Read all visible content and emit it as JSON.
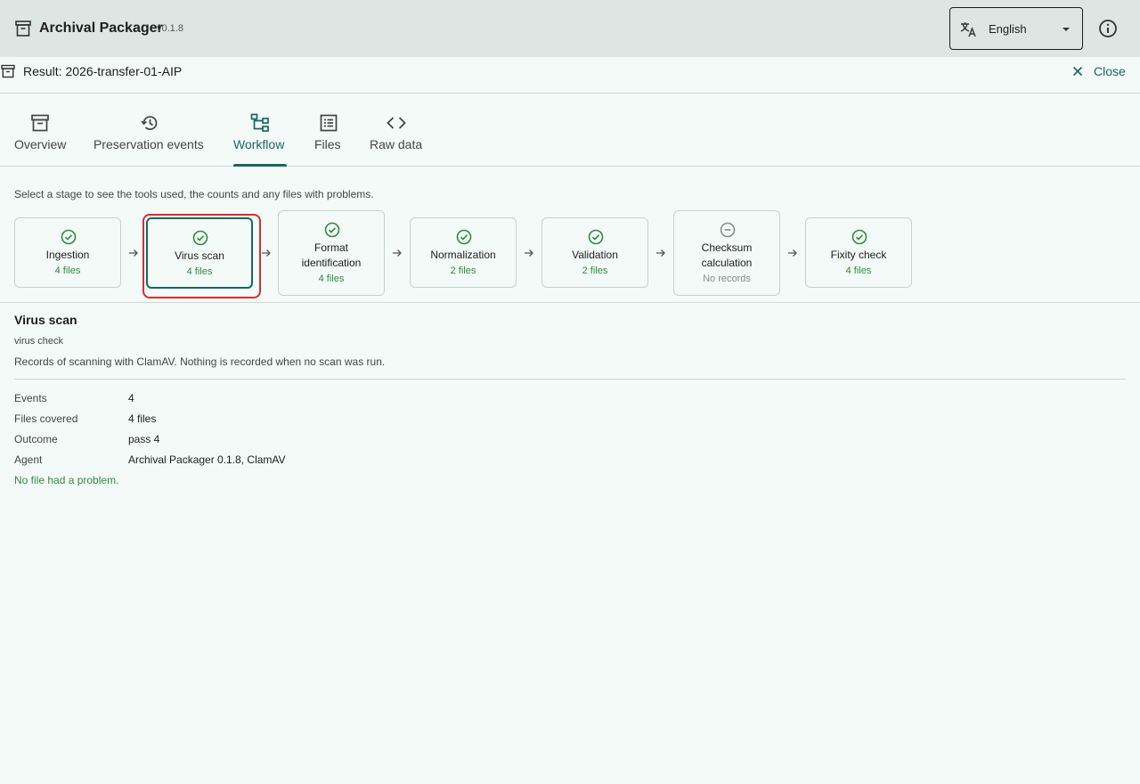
{
  "app": {
    "title": "Archival Packager",
    "version": "v0.1.8"
  },
  "language": {
    "selected": "English"
  },
  "result": {
    "title": "Result: 2026-transfer-01-AIP",
    "close_label": "Close"
  },
  "tabs": [
    {
      "label": "Overview",
      "icon": "archive-icon"
    },
    {
      "label": "Preservation events",
      "icon": "history-icon"
    },
    {
      "label": "Workflow",
      "icon": "workflow-icon",
      "active": true
    },
    {
      "label": "Files",
      "icon": "list-icon"
    },
    {
      "label": "Raw data",
      "icon": "code-icon"
    }
  ],
  "instructions": "Select a stage to see the tools used, the counts and any files with problems.",
  "stages": [
    {
      "name": "Ingestion",
      "count": "4 files",
      "status": "success"
    },
    {
      "name": "Virus scan",
      "count": "4 files",
      "status": "success",
      "selected": true
    },
    {
      "name": "Format identification",
      "count": "4 files",
      "status": "success"
    },
    {
      "name": "Normalization",
      "count": "2 files",
      "status": "success"
    },
    {
      "name": "Validation",
      "count": "2 files",
      "status": "success"
    },
    {
      "name": "Checksum calculation",
      "count": "No records",
      "status": "none"
    },
    {
      "name": "Fixity check",
      "count": "4 files",
      "status": "success"
    }
  ],
  "detail": {
    "title": "Virus scan",
    "subtitle": "virus check",
    "description": "Records of scanning with ClamAV. Nothing is recorded when no scan was run.",
    "rows": [
      {
        "key": "Events",
        "value": "4"
      },
      {
        "key": "Files covered",
        "value": "4 files"
      },
      {
        "key": "Outcome",
        "value": "pass 4"
      },
      {
        "key": "Agent",
        "value": "Archival Packager 0.1.8, ClamAV"
      }
    ],
    "problems_message": "No file had a problem."
  },
  "colors": {
    "accent": "#17695e",
    "success": "#2e8b3e",
    "selection_outline": "#d32f2f",
    "app_bar": "#dfe5e3",
    "background": "#f4faf8"
  }
}
